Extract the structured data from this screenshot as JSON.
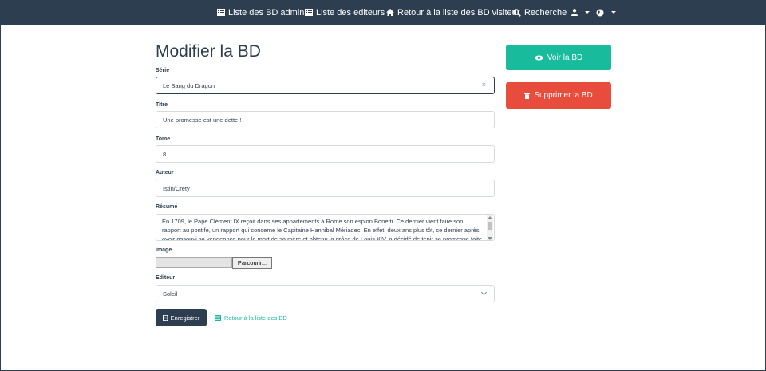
{
  "navbar": {
    "admin_list": "Liste des BD admin",
    "editors_list": "Liste des editeurs",
    "visitor_list": "Retour à la liste des BD visiteur",
    "search": "Recherche"
  },
  "form": {
    "title": "Modifier la BD",
    "serie_label": "Série",
    "serie_value": "Le Sang du Dragon",
    "titre_label": "Titre",
    "titre_value": "Une promesse est une dette !",
    "tome_label": "Tome",
    "tome_value": "8",
    "auteur_label": "Auteur",
    "auteur_value": "Istin/Créty",
    "resume_label": "Résumé",
    "resume_value": "En 1709, le Pape Clément IX reçoit dans ses appartements à Rome son espion Bonetti. Ce dernier vient faire son rapport au pontife, un rapport qui concerne le Capitaine Hannibal Mériadec. En effet, deux ans plus tôt, ce dernier après avoir assouvi sa vengeance pour la mort de sa mère et obtenu la grâce de Louis XIV, a décidé de tenir sa promesse faite à sa",
    "image_label": "image",
    "browse_label": "Parcourir...",
    "editeur_label": "Editeur",
    "editeur_value": "Soleil",
    "save_label": "Enregistrer",
    "back_label": "Retour à la liste des BD"
  },
  "actions": {
    "view_label": "Voir la BD",
    "delete_label": "Supprimer la BD"
  },
  "colors": {
    "navbar": "#2c3e50",
    "success": "#18bc9c",
    "danger": "#e74c3c"
  }
}
